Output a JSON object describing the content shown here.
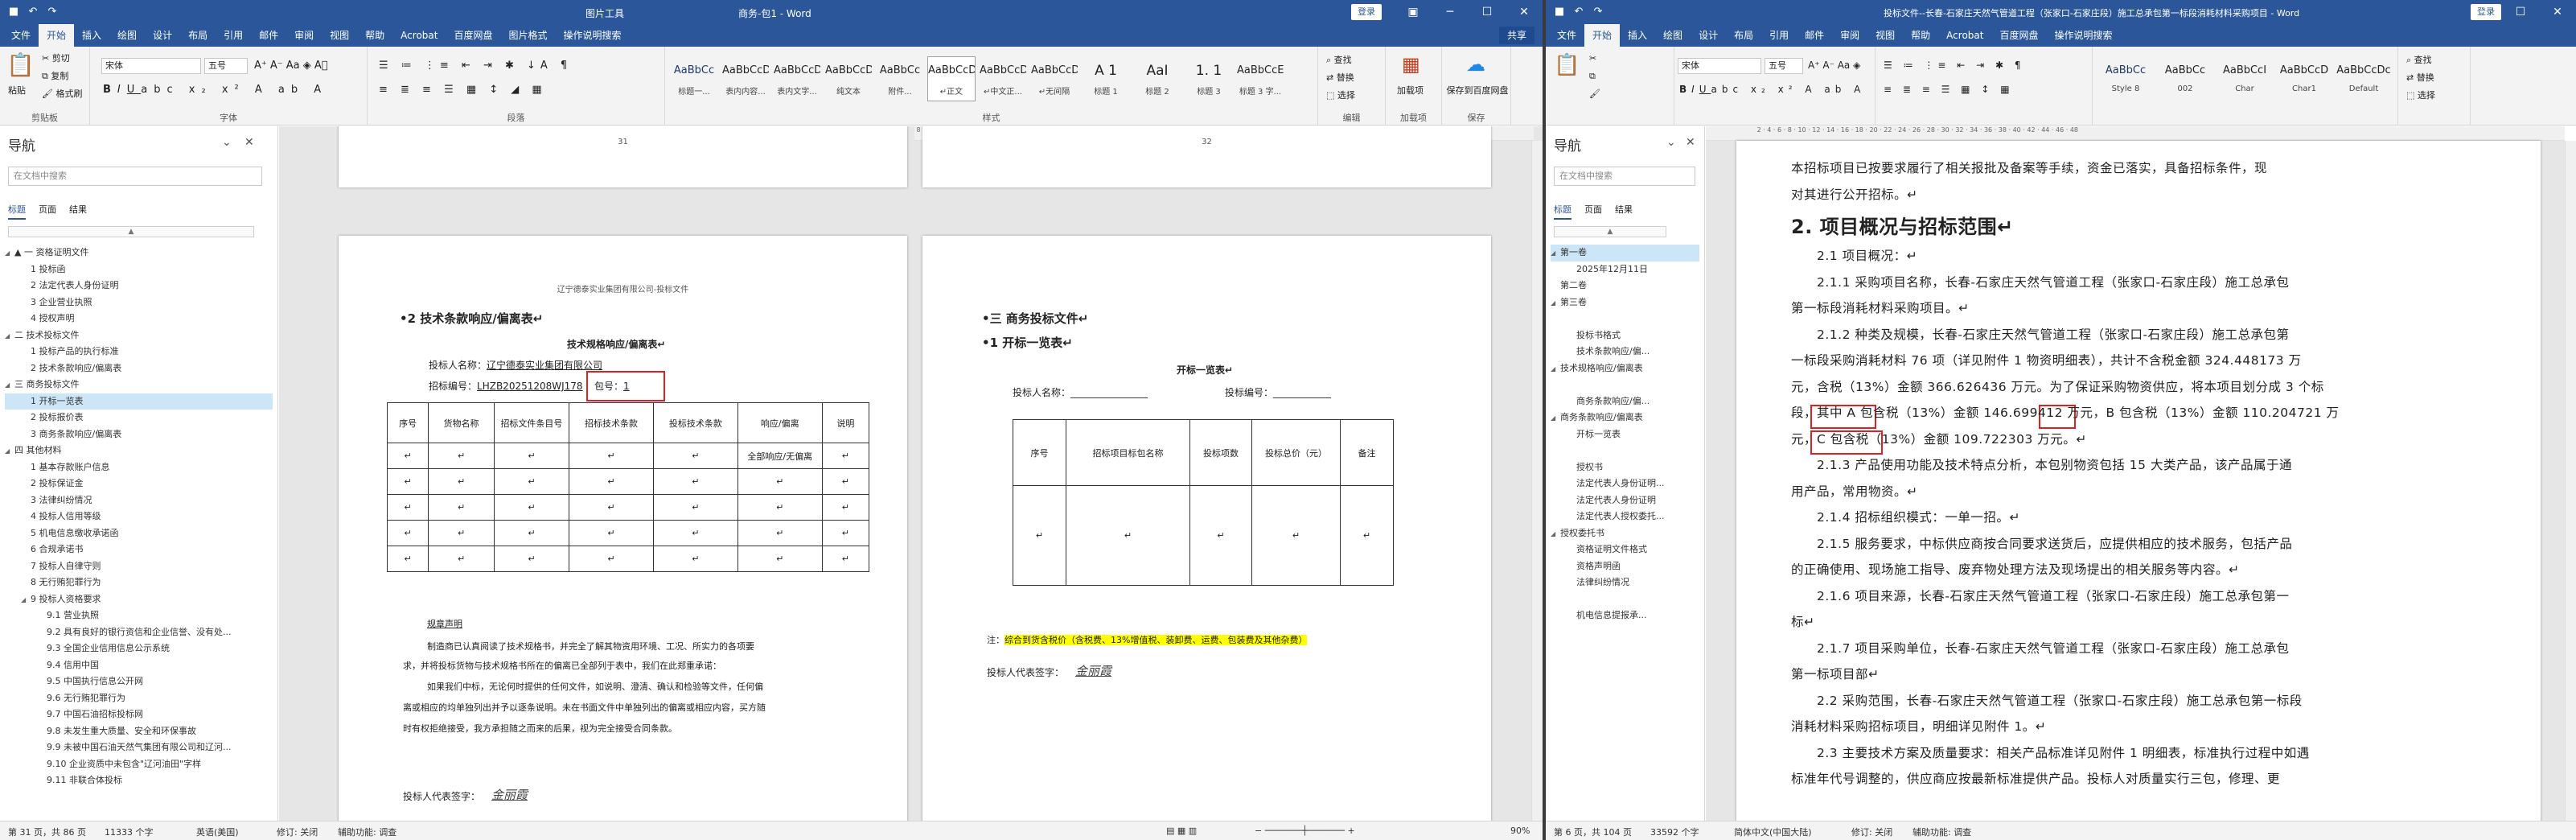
{
  "left": {
    "title_tools": "图片工具",
    "title": "商务-包1  -  Word",
    "login": "登录",
    "share": "共享",
    "tabs": [
      "文件",
      "开始",
      "插入",
      "绘图",
      "设计",
      "布局",
      "引用",
      "邮件",
      "审阅",
      "视图",
      "帮助",
      "Acrobat",
      "百度网盘",
      "图片格式"
    ],
    "tell_me": "操作说明搜索",
    "ribbon": {
      "paste": "粘贴",
      "cut": "剪切",
      "copy": "复制",
      "format_painter": "格式刷",
      "clipboard": "剪贴板",
      "font_name": "宋体",
      "font_size": "五号",
      "font_group": "字体",
      "para_group": "段落",
      "styles": [
        {
          "s": "AaBbCc",
          "n": "标题一..."
        },
        {
          "s": "AaBbCcD",
          "n": "表内内容..."
        },
        {
          "s": "AaBbCcDd",
          "n": "表内文字..."
        },
        {
          "s": "AaBbCcDd",
          "n": "纯文本"
        },
        {
          "s": "AaBbCc",
          "n": "附件..."
        },
        {
          "s": "AaBbCcDd",
          "n": "↵正文"
        },
        {
          "s": "AaBbCcDc",
          "n": "↵中文正..."
        },
        {
          "s": "AaBbCcDd",
          "n": "↵无间隔"
        },
        {
          "s": "A 1",
          "n": "标题 1"
        },
        {
          "s": "AaI",
          "n": "标题 2"
        },
        {
          "s": "1. 1",
          "n": "标题 3"
        },
        {
          "s": "AaBbCcE",
          "n": "标题 3 字..."
        }
      ],
      "styles_group": "样式",
      "find": "查找",
      "replace": "替换",
      "select": "选择",
      "edit_group": "编辑",
      "addin": "加载项",
      "addin_group": "加载项",
      "baidu_save": "保存到百度网盘",
      "save_group": "保存"
    },
    "nav": {
      "title": "导航",
      "search": "在文档中搜索",
      "tabs": [
        "标题",
        "页面",
        "结果"
      ],
      "items": [
        {
          "t": "▲ 一 资格证明文件",
          "l": 0,
          "ar": "◢"
        },
        {
          "t": "1 投标函",
          "l": 1
        },
        {
          "t": "2 法定代表人身份证明",
          "l": 1
        },
        {
          "t": "3 企业营业执照",
          "l": 1
        },
        {
          "t": "4 授权声明",
          "l": 1
        },
        {
          "t": "二 技术投标文件",
          "l": 0,
          "ar": "◢"
        },
        {
          "t": "1 投标产品的执行标准",
          "l": 1
        },
        {
          "t": "2 技术条款响应/偏离表",
          "l": 1
        },
        {
          "t": "三 商务投标文件",
          "l": 0,
          "ar": "◢"
        },
        {
          "t": "1 开标一览表",
          "l": 1,
          "sel": true
        },
        {
          "t": "2 投标报价表",
          "l": 1
        },
        {
          "t": "3 商务条款响应/偏离表",
          "l": 1
        },
        {
          "t": "四 其他材料",
          "l": 0,
          "ar": "◢"
        },
        {
          "t": "1 基本存款账户信息",
          "l": 1
        },
        {
          "t": "2 投标保证金",
          "l": 1
        },
        {
          "t": "3 法律纠纷情况",
          "l": 1
        },
        {
          "t": "4 投标人信用等级",
          "l": 1
        },
        {
          "t": "5 机电信息缴收承诺函",
          "l": 1
        },
        {
          "t": "6 合规承诺书",
          "l": 1
        },
        {
          "t": "7 投标人自律守则",
          "l": 1
        },
        {
          "t": "8 无行贿犯罪行为",
          "l": 1
        },
        {
          "t": "9 投标人资格要求",
          "l": 1,
          "ar": "◢"
        },
        {
          "t": "9.1 营业执照",
          "l": 2
        },
        {
          "t": "9.2 具有良好的银行资信和企业信誉、没有处...",
          "l": 2
        },
        {
          "t": "9.3 全国企业信用信息公示系统",
          "l": 2
        },
        {
          "t": "9.4 信用中国",
          "l": 2
        },
        {
          "t": "9.5 中国执行信息公开网",
          "l": 2
        },
        {
          "t": "9.6 无行贿犯罪行为",
          "l": 2
        },
        {
          "t": "9.7 中国石油招标投标网",
          "l": 2
        },
        {
          "t": "9.8 未发生重大质量、安全和环保事故",
          "l": 2
        },
        {
          "t": "9.9 未被中国石油天然气集团有限公司和辽河...",
          "l": 2
        },
        {
          "t": "9.10 企业资质中未包含\"辽河油田\"字样",
          "l": 2
        },
        {
          "t": "9.11 非联合体投标",
          "l": 2
        }
      ]
    },
    "page_a": {
      "page_no": "31",
      "header": "辽宁德泰实业集团有限公司-投标文件",
      "heading": "•2  技术条款响应/偏离表↵",
      "table_title": "技术规格响应/偏离表↵",
      "bidder_label": "投标人名称：",
      "bidder_name": "辽宁德泰实业集团有限公司",
      "code_label": "招标编号：",
      "code": "LHZB20251208WJ178",
      "pkg_label": "包号：",
      "pkg": "1",
      "cols": [
        "序号",
        "货物名称",
        "招标文件条目号",
        "招标技术条款",
        "投标技术条款",
        "响应/偏离",
        "说明"
      ],
      "row1_resp": "全部响应/无偏离",
      "note_title": "规章声明",
      "note1": "制造商已认真阅读了技术规格书，并完全了解其物资用环境、工况、所实力的各项要",
      "note2": "求，并将投标货物与技术规格书所在的偏离已全部列于表中，我们在此郑重承诺：",
      "note3": "如果我们中标，无论何时提供的任何文件，如说明、澄清、确认和检验等文件，任何偏",
      "note4": "离或相应的均单独列出并予以逐条说明。未在书面文件中单独列出的偏离或相应内容，买方随",
      "note5": "时有权拒绝接受，我方承担随之而来的后果，视为完全接受合同条款。",
      "sign_label": "投标人代表签字：",
      "sign": "金丽霞"
    },
    "page_b": {
      "page_no": "32",
      "heading1": "•三  商务投标文件↵",
      "heading2": "•1  开标一览表↵",
      "table_title": "开标一览表↵",
      "bidder_label": "投标人名称：",
      "code_label": "投标编号：",
      "cols": [
        "序号",
        "招标项目标包名称",
        "投标项数",
        "投标总价（元）",
        "备注"
      ],
      "note_prefix": "注：",
      "note_hl": "综合到货含税价（含税费、13%增值税、装卸费、运费、包装费及其他杂费）",
      "sign_label": "投标人代表签字：",
      "sign": "金丽霞"
    },
    "status": {
      "page": "第 31 页，共 86 页",
      "words": "11333 个字",
      "lang": "英语(美国)",
      "track": "修订: 关闭",
      "access": "辅助功能: 调查",
      "zoom": "90%"
    }
  },
  "right": {
    "title": "投标文件--长春-石家庄天然气管道工程（张家口-石家庄段）施工总承包第一标段消耗材料采购项目  -  Word",
    "login": "登录",
    "tabs": [
      "文件",
      "开始",
      "插入",
      "绘图",
      "设计",
      "布局",
      "引用",
      "邮件",
      "审阅",
      "视图",
      "帮助",
      "Acrobat",
      "百度网盘"
    ],
    "tell_me": "操作说明搜索",
    "ribbon": {
      "font_name": "宋体",
      "font_size": "五号",
      "styles": [
        {
          "s": "AaBbCc",
          "n": "Style 8"
        },
        {
          "s": "AaBbCc",
          "n": "002"
        },
        {
          "s": "AaBbCcI",
          "n": "Char"
        },
        {
          "s": "AaBbCcD",
          "n": "Char1"
        },
        {
          "s": "AaBbCcDc",
          "n": "Default"
        }
      ],
      "find": "查找",
      "replace": "替换",
      "select": "选择"
    },
    "nav": {
      "title": "导航",
      "search": "在文档中搜索",
      "tabs": [
        "标题",
        "页面",
        "结果"
      ],
      "items": [
        {
          "t": "第一卷",
          "l": 0,
          "ar": "◢",
          "sel": true
        },
        {
          "t": "2025年12月11日",
          "l": 1
        },
        {
          "t": "第二卷",
          "l": 0
        },
        {
          "t": "第三卷",
          "l": 0,
          "ar": "◢"
        },
        {
          "t": "",
          "l": 1
        },
        {
          "t": "投标书格式",
          "l": 1
        },
        {
          "t": "技术条款响应/偏...",
          "l": 1
        },
        {
          "t": "技术规格响应/偏离表",
          "l": 0,
          "ar": "◢"
        },
        {
          "t": "",
          "l": 1
        },
        {
          "t": "商务条款响应/偏...",
          "l": 1
        },
        {
          "t": "商务条款响应/偏离表",
          "l": 0,
          "ar": "◢"
        },
        {
          "t": "开标一览表",
          "l": 1
        },
        {
          "t": "",
          "l": 1
        },
        {
          "t": "授权书",
          "l": 1
        },
        {
          "t": "法定代表人身份证明...",
          "l": 1
        },
        {
          "t": "法定代表人身份证明",
          "l": 1
        },
        {
          "t": "法定代表人授权委托...",
          "l": 1
        },
        {
          "t": "授权委托书",
          "l": 0,
          "ar": "◢"
        },
        {
          "t": "资格证明文件格式",
          "l": 1
        },
        {
          "t": "资格声明函",
          "l": 1
        },
        {
          "t": "法律纠纷情况",
          "l": 1
        },
        {
          "t": "",
          "l": 1
        },
        {
          "t": "机电信息提报承...",
          "l": 1
        }
      ]
    },
    "doc": [
      "本招标项目已按要求履行了相关报批及备案等手续，资金已落实，具备招标条件，现",
      "对其进行公开招标。↵",
      "2. 项目概况与招标范围↵",
      "2.1 项目概况：↵",
      "2.1.1 采购项目名称，长春-石家庄天然气管道工程（张家口-石家庄段）施工总承包",
      "第一标段消耗材料采购项目。↵",
      "2.1.2 种类及规模，长春-石家庄天然气管道工程（张家口-石家庄段）施工总承包第",
      "一标段采购消耗材料 76 项（详见附件 1 物资明细表），共计不含税金额 324.448173 万",
      "元，含税（13%）金额 366.626436 万元。为了保证采购物资供应，将本项目划分成 3 个标",
      "段，其中 A 包含税（13%）金额 146.699412 万元，B 包含税（13%）金额 110.204721 万",
      "元，C 包含税（13%）金额 109.722303 万元。↵",
      "2.1.3 产品使用功能及技术特点分析，本包别物资包括 15 大类产品，该产品属于通",
      "用产品，常用物资。↵",
      "2.1.4 招标组织模式：一单一招。↵",
      "2.1.5 服务要求，中标供应商按合同要求送货后，应提供相应的技术服务，包括产品",
      "的正确使用、现场施工指导、废弃物处理方法及现场提出的相关服务等内容。↵",
      "2.1.6 项目来源，长春-石家庄天然气管道工程（张家口-石家庄段）施工总承包第一",
      "标↵",
      "2.1.7 项目采购单位，长春-石家庄天然气管道工程（张家口-石家庄段）施工总承包",
      "第一标项目部↵",
      "2.2 采购范围，长春-石家庄天然气管道工程（张家口-石家庄段）施工总承包第一标段",
      "消耗材料采购招标项目，明细详见附件 1。↵",
      "2.3 主要技术方案及质量要求：相关产品标准详见附件 1 明细表，标准执行过程中如遇",
      "标准年代号调整的，供应商应按最新标准提供产品。投标人对质量实行三包，修理、更"
    ],
    "status": {
      "page": "第 6 页，共 104 页",
      "words": "33592 个字",
      "lang": "简体中文(中国大陆)",
      "track": "修订: 关闭",
      "access": "辅助功能: 调查"
    }
  }
}
